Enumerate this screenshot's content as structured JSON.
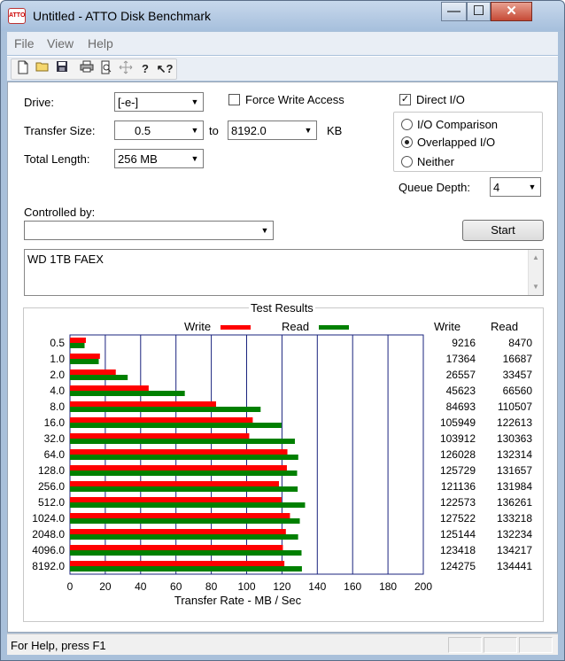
{
  "window": {
    "title": "Untitled - ATTO Disk Benchmark",
    "icon_text": "ATTO",
    "min_glyph": "—",
    "max_glyph": "☐",
    "close_glyph": "✕"
  },
  "menu": [
    "File",
    "View",
    "Help"
  ],
  "toolbar": [
    "new-icon",
    "open-icon",
    "save-icon",
    "print-icon",
    "print-preview-icon",
    "move-icon",
    "help-icon",
    "context-help-icon"
  ],
  "form": {
    "drive_label": "Drive:",
    "drive_value": "[-e-]",
    "force_write_label": "Force Write Access",
    "force_write_checked": false,
    "direct_io_label": "Direct I/O",
    "direct_io_checked": true,
    "transfer_size_label": "Transfer Size:",
    "transfer_from": "0.5",
    "to_label": "to",
    "transfer_to": "8192.0",
    "kb_label": "KB",
    "total_length_label": "Total Length:",
    "total_length_value": "256 MB",
    "io_modes": [
      {
        "label": "I/O Comparison",
        "selected": false
      },
      {
        "label": "Overlapped I/O",
        "selected": true
      },
      {
        "label": "Neither",
        "selected": false
      }
    ],
    "queue_depth_label": "Queue Depth:",
    "queue_depth_value": "4",
    "controlled_by_label": "Controlled by:",
    "controlled_by_value": "",
    "start_label": "Start",
    "notes": "WD 1TB FAEX"
  },
  "results": {
    "title": "Test Results",
    "write_col": "Write",
    "read_col": "Read",
    "write_color": "#ff0000",
    "read_color": "#008000"
  },
  "chart_data": {
    "type": "bar",
    "title": "Test Results",
    "xlabel": "Transfer Rate - MB / Sec",
    "xlim": [
      0,
      200
    ],
    "xticks": [
      "0",
      "20",
      "40",
      "60",
      "80",
      "100",
      "120",
      "140",
      "160",
      "180",
      "200"
    ],
    "categories": [
      "0.5",
      "1.0",
      "2.0",
      "4.0",
      "8.0",
      "16.0",
      "32.0",
      "64.0",
      "128.0",
      "256.0",
      "512.0",
      "1024.0",
      "2048.0",
      "4096.0",
      "8192.0"
    ],
    "series": [
      {
        "name": "Write",
        "color": "#ff0000",
        "values": [
          9216,
          17364,
          26557,
          45623,
          84693,
          105949,
          103912,
          126028,
          125729,
          121136,
          122573,
          127522,
          125144,
          123418,
          124275
        ]
      },
      {
        "name": "Read",
        "color": "#008000",
        "values": [
          8470,
          16687,
          33457,
          66560,
          110507,
          122613,
          130363,
          132314,
          131657,
          131984,
          136261,
          133218,
          132234,
          134217,
          134441
        ]
      }
    ]
  },
  "status": {
    "text": "For Help, press F1"
  }
}
